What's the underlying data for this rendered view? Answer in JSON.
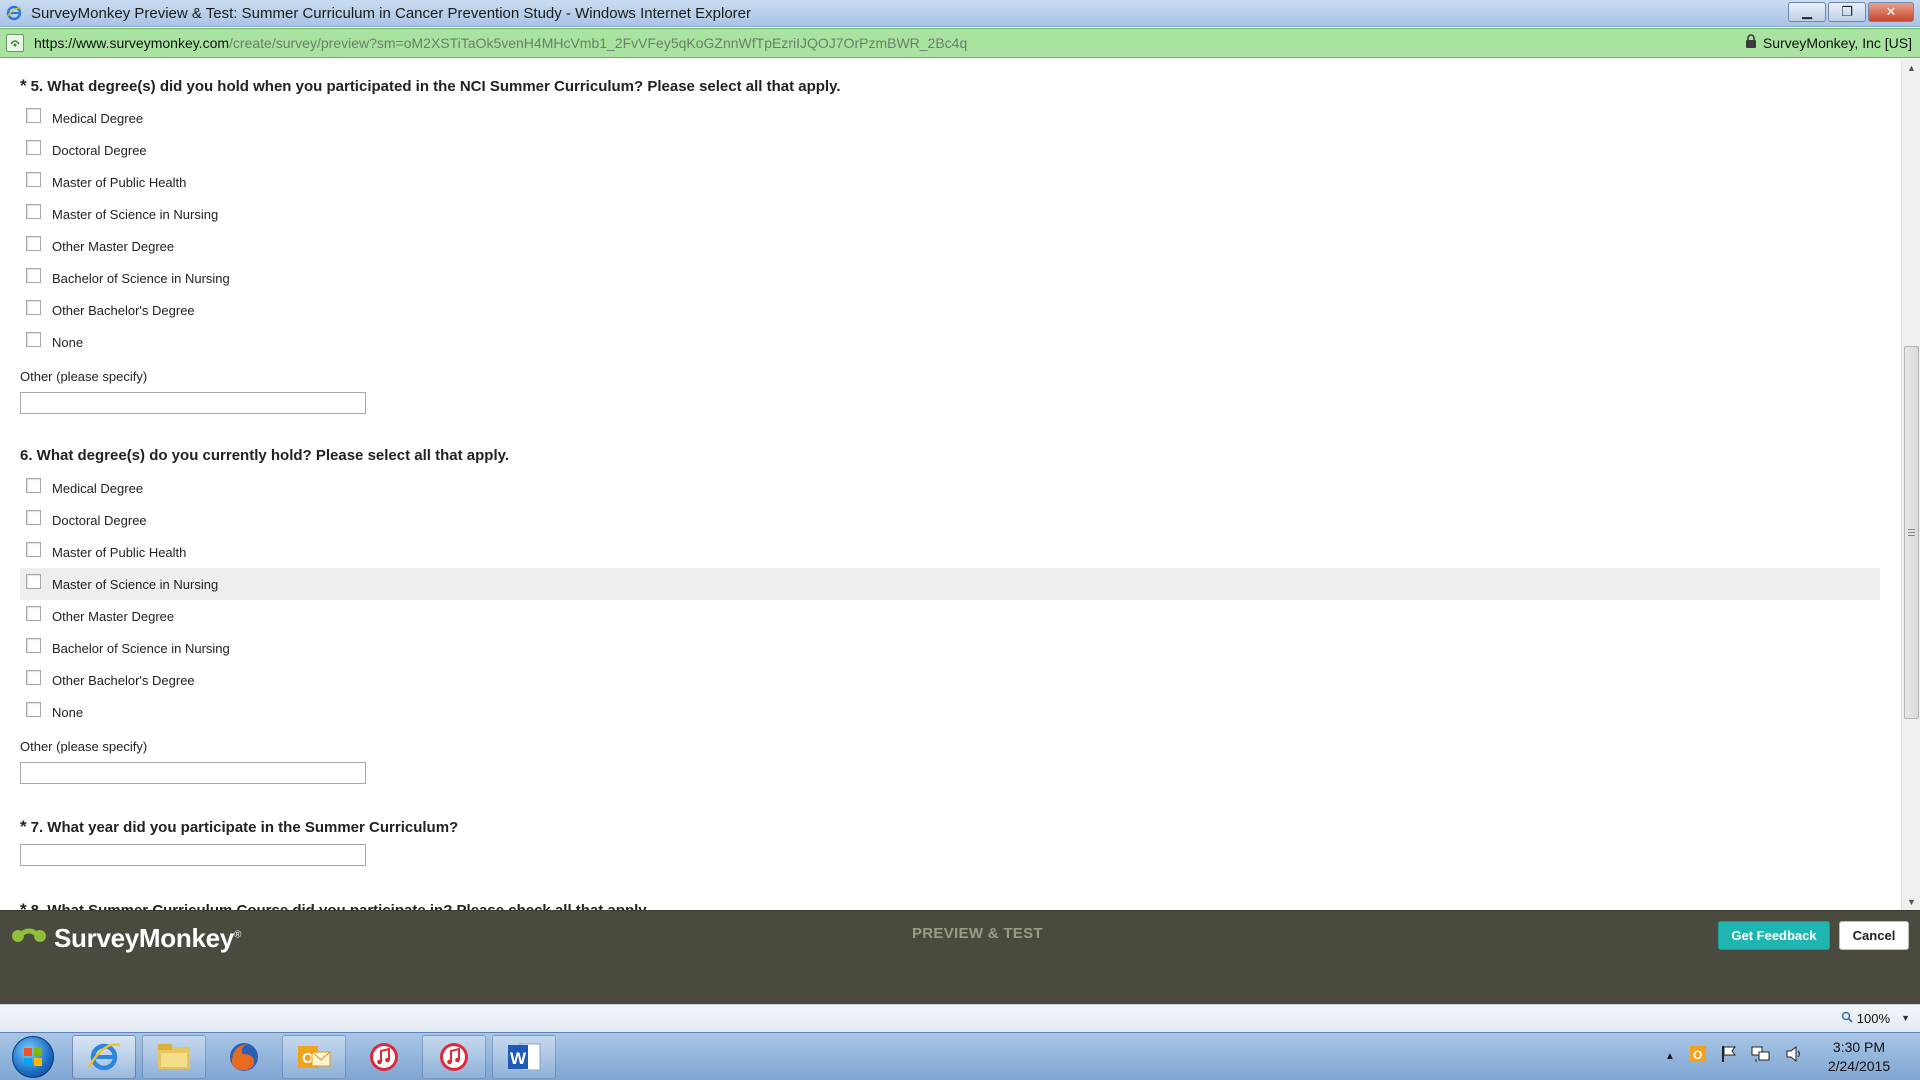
{
  "window": {
    "title": "SurveyMonkey Preview & Test: Summer Curriculum in Cancer Prevention Study - Windows Internet Explorer",
    "minimize_icon": "minimize-icon",
    "restore_icon": "restore-icon",
    "close_icon": "close-icon"
  },
  "address": {
    "host": "https://www.surveymonkey.com",
    "path": "/create/survey/preview?sm=oM2XSTiTaOk5venH4MHcVmb1_2FvVFey5qKoGZnnWfTpEzriIJQOJ7OrPzmBWR_2Bc4q",
    "security_label": "SurveyMonkey, Inc [US]"
  },
  "survey": {
    "q5": {
      "star": "*",
      "title": "5. What degree(s) did you hold when you participated in the NCI Summer Curriculum? Please select all that apply.",
      "options": [
        "Medical Degree",
        "Doctoral Degree",
        "Master of Public Health",
        "Master of Science in Nursing",
        "Other Master Degree",
        "Bachelor of Science in Nursing",
        "Other Bachelor's Degree",
        "None"
      ],
      "other_label": "Other (please specify)",
      "other_value": ""
    },
    "q6": {
      "title": "6. What degree(s) do you currently hold? Please select all that apply.",
      "options": [
        "Medical Degree",
        "Doctoral Degree",
        "Master of Public Health",
        "Master of Science in Nursing",
        "Other Master Degree",
        "Bachelor of Science in Nursing",
        "Other Bachelor's Degree",
        "None"
      ],
      "other_label": "Other (please specify)",
      "other_value": ""
    },
    "q7": {
      "star": "*",
      "title": "7. What year did you participate in the Summer Curriculum?",
      "value": ""
    },
    "q8": {
      "star": "*",
      "title": "8. What Summer Curriculum Course did you participate in? Please check all that apply."
    }
  },
  "preview_bar": {
    "logo_text": "SurveyMonkey",
    "logo_mark": "®",
    "label": "PREVIEW & TEST",
    "feedback_button": "Get Feedback",
    "cancel_button": "Cancel"
  },
  "status_bar": {
    "zoom": "100%"
  },
  "taskbar": {
    "time": "3:30 PM",
    "date": "2/24/2015"
  },
  "colors": {
    "address_bar": "#a8e4a0",
    "preview_bar": "#4b4a3e",
    "feedback_button": "#1fb6b1"
  }
}
